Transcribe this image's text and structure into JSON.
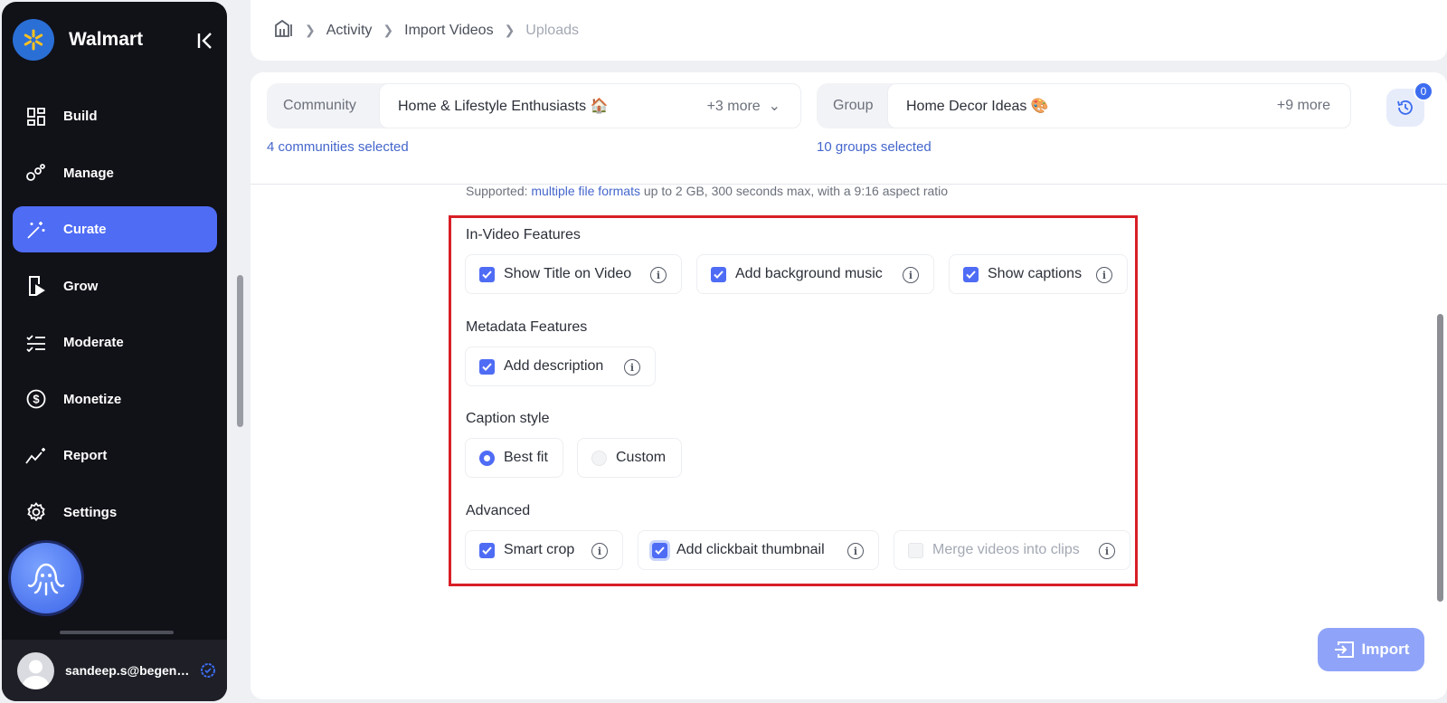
{
  "sidebar": {
    "brand": "Walmart",
    "items": [
      {
        "label": "Build",
        "icon": "grid-icon"
      },
      {
        "label": "Manage",
        "icon": "nodes-icon"
      },
      {
        "label": "Curate",
        "icon": "magic-wand-icon",
        "active": true
      },
      {
        "label": "Grow",
        "icon": "play-phone-icon"
      },
      {
        "label": "Moderate",
        "icon": "checklist-icon"
      },
      {
        "label": "Monetize",
        "icon": "dollar-icon"
      },
      {
        "label": "Report",
        "icon": "sparkline-icon"
      },
      {
        "label": "Settings",
        "icon": "gear-icon"
      }
    ],
    "user_email": "sandeep.s@begenuin.com"
  },
  "breadcrumb": {
    "home_icon": "home-icon",
    "items": [
      "Activity",
      "Import Videos",
      "Uploads"
    ]
  },
  "filters": {
    "community": {
      "label": "Community",
      "value": "Home & Lifestyle Enthusiasts 🏠",
      "more": "+3 more",
      "note": "4 communities selected"
    },
    "group": {
      "label": "Group",
      "value": "Home Decor Ideas 🎨",
      "more": "+9 more",
      "note": "10 groups selected"
    },
    "history_badge": "0"
  },
  "supported": {
    "prefix": "Supported: ",
    "link": "multiple file formats",
    "suffix": " up to 2 GB, 300 seconds max, with a 9:16 aspect ratio"
  },
  "features": {
    "in_video": {
      "title": "In-Video Features",
      "options": [
        {
          "label": "Show Title on Video",
          "checked": true
        },
        {
          "label": "Add background music",
          "checked": true
        },
        {
          "label": "Show captions",
          "checked": true
        }
      ]
    },
    "metadata": {
      "title": "Metadata Features",
      "options": [
        {
          "label": "Add description",
          "checked": true
        }
      ]
    },
    "caption_style": {
      "title": "Caption style",
      "options": [
        {
          "label": "Best fit",
          "selected": true
        },
        {
          "label": "Custom",
          "selected": false
        }
      ]
    },
    "advanced": {
      "title": "Advanced",
      "options": [
        {
          "label": "Smart crop",
          "checked": true
        },
        {
          "label": "Add clickbait thumbnail",
          "checked": true
        },
        {
          "label": "Merge videos into clips",
          "checked": false,
          "disabled": true
        }
      ]
    }
  },
  "import_button": "Import",
  "colors": {
    "accent": "#4f6cf5",
    "highlight": "#d81f26",
    "sidebar_bg": "#111118"
  }
}
